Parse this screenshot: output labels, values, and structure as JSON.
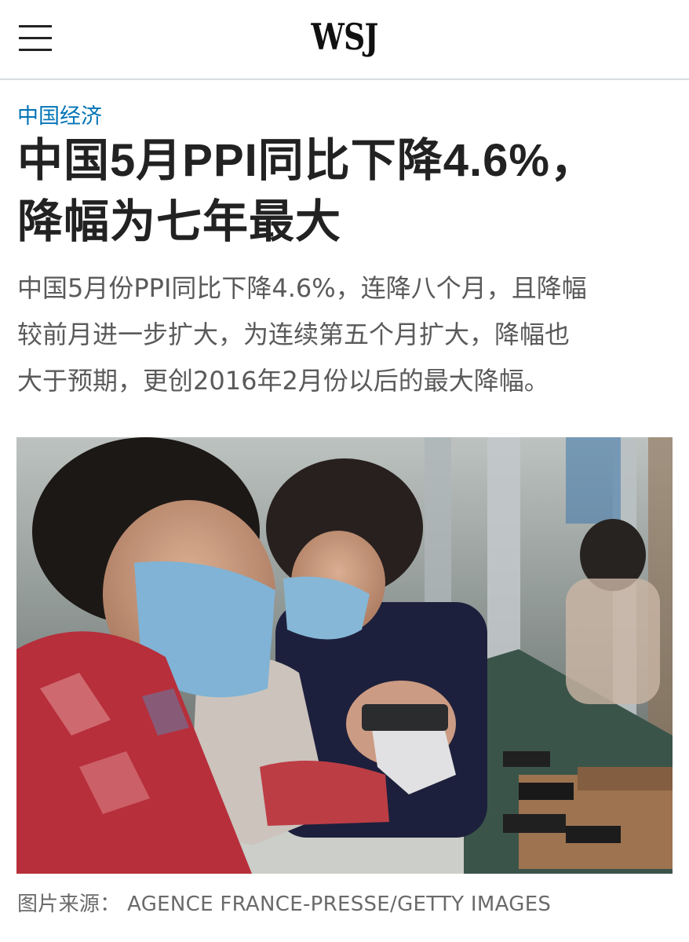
{
  "header": {
    "menu_icon": "hamburger-menu-icon",
    "logo": "WSJ"
  },
  "article": {
    "category": "中国经济",
    "headline_line1": "中国5月PPI同比下降4.6%，",
    "headline_line2": "降幅为七年最大",
    "summary_line1": "中国5月份PPI同比下降4.6%，连降八个月，且降幅",
    "summary_line2": "较前月进一步扩大，为连续第五个月扩大，降幅也",
    "summary_line3": "大于预期，更创2016年2月份以后的最大降幅。"
  },
  "photo": {
    "credit": "图片来源： AGENCE FRANCE-PRESSE/GETTY IMAGES"
  },
  "colors": {
    "accent": "#0274b6",
    "headline": "#222222",
    "summary": "#5a5a5a",
    "divider": "#d7dde0"
  }
}
